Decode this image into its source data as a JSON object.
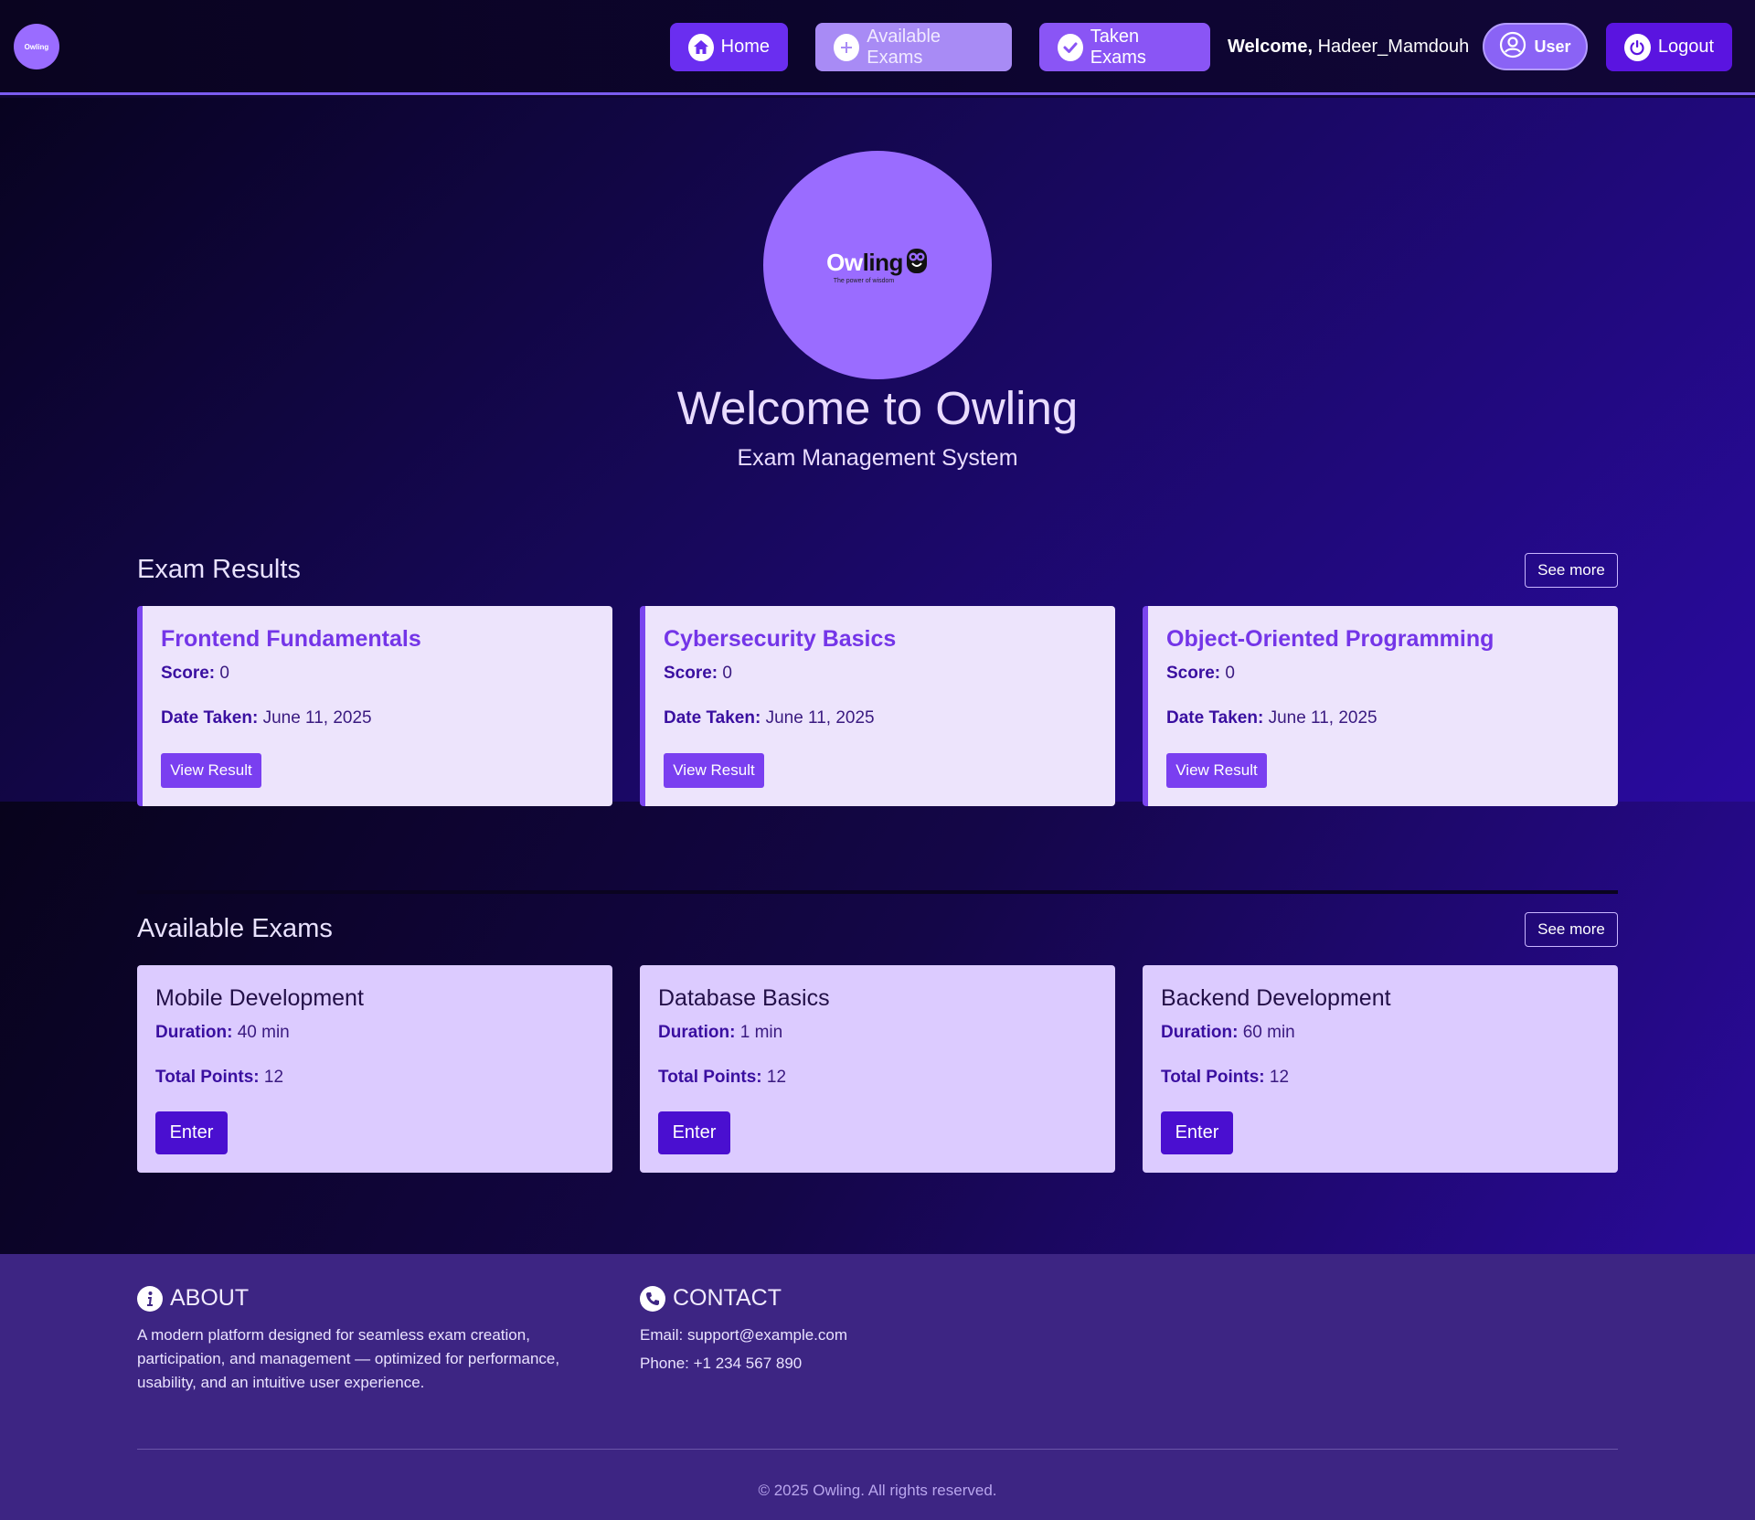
{
  "nav": {
    "logo_text": "Owling",
    "home_label": "Home",
    "available_label": "Available Exams",
    "taken_label": "Taken Exams",
    "welcome_prefix": "Welcome,",
    "username": "Hadeer_Mamdouh",
    "user_label": "User",
    "logout_label": "Logout"
  },
  "hero": {
    "logo_word_light": "Ow",
    "logo_word_dark": "l",
    "logo_word_end": "ing",
    "logo_tagline": "The power of wisdom",
    "title": "Welcome to Owling",
    "subtitle": "Exam Management System"
  },
  "results": {
    "title": "Exam Results",
    "see_more": "See more",
    "cards": [
      {
        "title": "Frontend Fundamentals",
        "score_label": "Score:",
        "score": "0",
        "date_label": "Date Taken:",
        "date": "June 11, 2025",
        "button": "View Result"
      },
      {
        "title": "Cybersecurity Basics",
        "score_label": "Score:",
        "score": "0",
        "date_label": "Date Taken:",
        "date": "June 11, 2025",
        "button": "View Result"
      },
      {
        "title": "Object-Oriented Programming",
        "score_label": "Score:",
        "score": "0",
        "date_label": "Date Taken:",
        "date": "June 11, 2025",
        "button": "View Result"
      }
    ]
  },
  "available": {
    "title": "Available Exams",
    "see_more": "See more",
    "cards": [
      {
        "title": "Mobile Development",
        "duration_label": "Duration:",
        "duration": "40 min",
        "points_label": "Total Points:",
        "points": "12",
        "button": "Enter"
      },
      {
        "title": "Database Basics",
        "duration_label": "Duration:",
        "duration": "1 min",
        "points_label": "Total Points:",
        "points": "12",
        "button": "Enter"
      },
      {
        "title": "Backend Development",
        "duration_label": "Duration:",
        "duration": "60 min",
        "points_label": "Total Points:",
        "points": "12",
        "button": "Enter"
      }
    ]
  },
  "footer": {
    "about_title": "ABOUT",
    "about_text": "A modern platform designed for seamless exam creation, participation, and management — optimized for performance, usability, and an intuitive user experience.",
    "contact_title": "CONTACT",
    "email": "Email: support@example.com",
    "phone": "Phone: +1 234 567 890",
    "copyright": "© 2025 Owling. All rights reserved."
  },
  "colors": {
    "accent": "#7a3ff0",
    "nav_bg": "#0a0420",
    "card_result_bg": "#ede4fc",
    "card_exam_bg": "#dccbff",
    "footer_bg": "#3d2583"
  }
}
